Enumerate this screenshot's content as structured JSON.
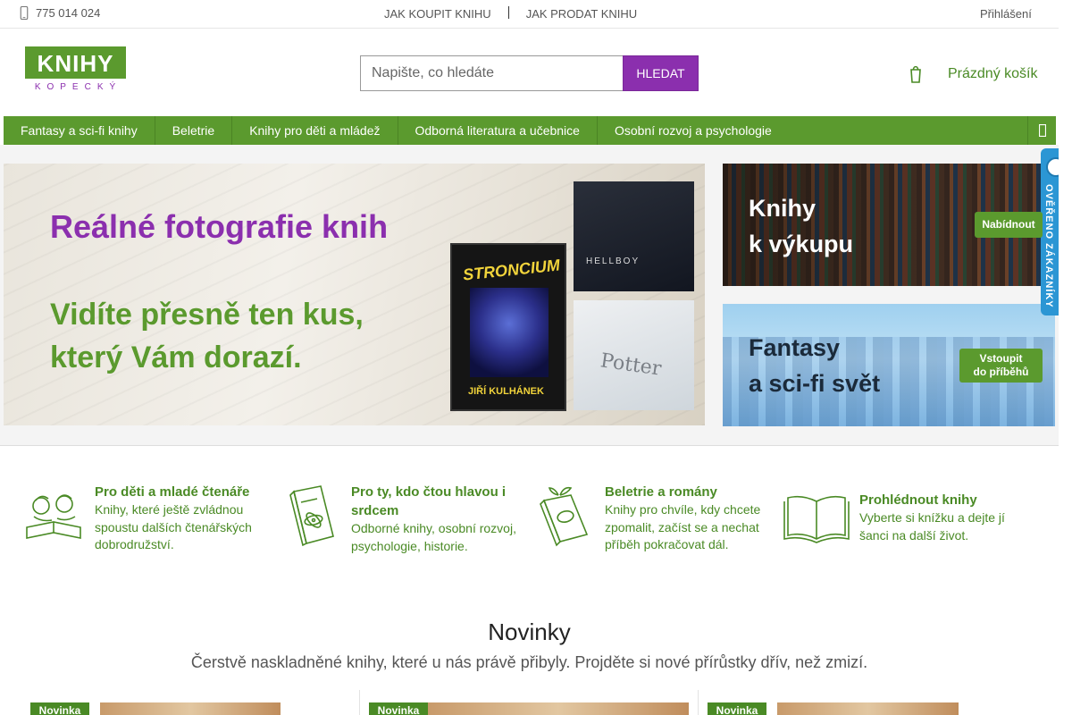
{
  "topbar": {
    "phone": "775 014 024",
    "link_buy": "JAK KOUPIT KNIHU",
    "link_sell": "JAK PRODAT KNIHU",
    "login": "Přihlášení"
  },
  "logo": {
    "main": "KNIHY",
    "sub": "KOPECKÝ"
  },
  "search": {
    "placeholder": "Napište, co hledáte",
    "button": "HLEDAT"
  },
  "cart": {
    "label": "Prázdný košík"
  },
  "nav": {
    "items": [
      "Fantasy a sci-fi knihy",
      "Beletrie",
      "Knihy pro děti a mládež",
      "Odborná literatura a učebnice",
      "Osobní rozvoj a psychologie"
    ]
  },
  "hero": {
    "headline": "Reálné fotografie knih",
    "line1": "Vidíte přesně ten kus,",
    "line2": "který Vám dorazí.",
    "book1_title": "STRONCIUM",
    "book1_author": "JIŘÍ KULHÁNEK",
    "book2_label": "HELLBOY",
    "book3_label": "Potter"
  },
  "banners": [
    {
      "title_line1": "Knihy",
      "title_line2": "k výkupu",
      "button": "Nabídnout"
    },
    {
      "title_line1": "Fantasy",
      "title_line2": "a sci-fi svět",
      "button_line1": "Vstoupit",
      "button_line2": "do příběhů"
    }
  ],
  "side_badge": {
    "text": "OVĚŘENO ZÁKAZNÍKY"
  },
  "features": [
    {
      "title": "Pro děti a mladé čtenáře",
      "desc": "Knihy, které ještě zvládnou spoustu dalších čtenářských dobrodružství.",
      "icon": "children-reading-icon"
    },
    {
      "title": "Pro ty, kdo čtou hlavou i srdcem",
      "desc": "Odborné knihy, osobní rozvoj, psychologie, historie.",
      "icon": "physics-book-icon"
    },
    {
      "title": "Beletrie a romány",
      "desc": "Knihy pro chvíle, kdy chcete zpomalit, začíst se a nechat příběh pokračovat dál.",
      "icon": "novel-book-icon"
    },
    {
      "title": "Prohlédnout knihy",
      "desc": "Vyberte si knížku a dejte jí šanci na další život.",
      "icon": "open-book-icon"
    }
  ],
  "novinky": {
    "title": "Novinky",
    "subtitle": "Čerstvě naskladněné knihy, které u nás právě přibyly. Projděte si nové přírůstky dřív, než zmizí.",
    "cards": [
      {
        "tag": "Novinka"
      },
      {
        "tag": "Novinka"
      },
      {
        "tag": "Novinka"
      }
    ]
  },
  "colors": {
    "brand_green": "#5b9a2e",
    "brand_purple": "#8b2fae",
    "badge_blue": "#2b96d4"
  }
}
